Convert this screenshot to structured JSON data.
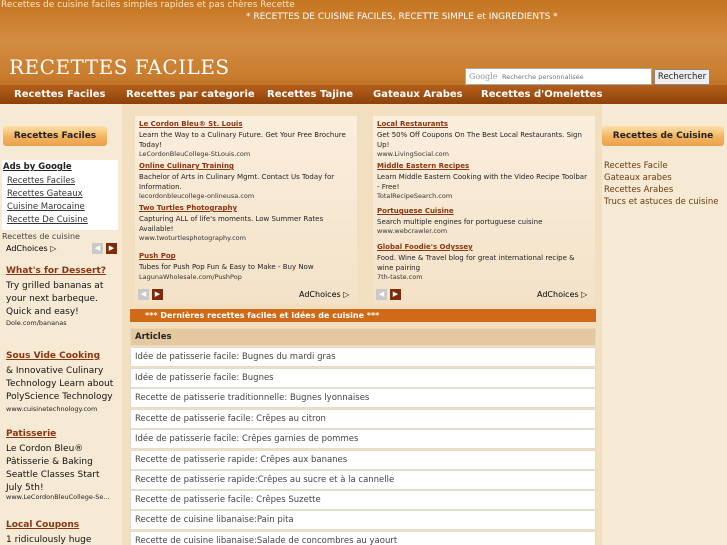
{
  "header": {
    "top_tagline": "Recettes de cuisine faciles simples rapides et pas chères Recette",
    "banner": "* RECETTES DE CUISINE FACILES, RECETTE SIMPLE et INGREDIENTS *",
    "site_title": "RECETTES FACILES",
    "google_mark": "Google",
    "search_placeholder": "Recherche personnalisée",
    "search_button": "Rechercher"
  },
  "nav": {
    "items": [
      "Recettes Faciles",
      "Recettes par categorie",
      "Recettes Tajine",
      "Gateaux Arabes",
      "Recettes d'Omelettes"
    ]
  },
  "left": {
    "header": "Recettes Faciles",
    "ads_by_google": "Ads by Google",
    "links": [
      "Recettes Faciles",
      "Recettes Gateaux",
      "Cuisine Marocaine",
      "Recette De Cuisine"
    ],
    "sub_label": "Recettes de cuisine",
    "adchoices": "AdChoices",
    "ads": [
      {
        "title": "What's for Dessert?",
        "body": "Try grilled bananas at your next barbeque. Quick and easy!",
        "url": "Dole.com/bananas"
      },
      {
        "title": "Sous Vide Cooking",
        "body": "& Innovative Culinary Technology Learn about PolyScience Technology",
        "url": "www.cuisinetechnology.com"
      },
      {
        "title": "Patisserie",
        "body": "Le Cordon Bleu® Pâtisserie & Baking Seattle Classes Start July 5th!",
        "url": "www.LeCordonBleuCollege-Se..."
      },
      {
        "title": "Local Coupons",
        "body": "1 ridiculously huge",
        "url": ""
      }
    ]
  },
  "center": {
    "adchoices": "AdChoices",
    "ad_panels": [
      {
        "ads": [
          {
            "title": "Le Cordon Bleu® St. Louis",
            "text": "Learn the Way to a Culinary Future. Get Your Free Brochure Today!",
            "url": "LeCordonBleuCollege-StLouis.com"
          },
          {
            "title": "Online Culinary Training",
            "text": "Bachelor of Arts in Culinary Mgmt. Contact Us Today for Information.",
            "url": "lecordonbleucollege-onlineusa.com"
          },
          {
            "title": "Two Turtles Photography",
            "text": "Capturing ALL of life's moments. Low Summer Rates Available!",
            "url": "www.twoturtlesphotography.com"
          },
          {
            "title": "Push Pop",
            "text": "Tubes for Push Pop Fun & Easy to Make - Buy Now",
            "url": "LagunaWholesale.com/PushPop"
          }
        ]
      },
      {
        "ads": [
          {
            "title": "Local Restaurants",
            "text": "Get 50% Off Coupons On The Best Local Restaurants. Sign Up!",
            "url": "www.LivingSocial.com"
          },
          {
            "title": "Middle Eastern Recipes",
            "text": "Learn Middle Eastern Cooking with the Video Recipe Toolbar - Free!",
            "url": "TotalRecipeSearch.com"
          },
          {
            "title": "Portuguese Cuisine",
            "text": "Search multiple engines for portuguese cuisine",
            "url": "www.webcrawler.com"
          },
          {
            "title": "Global Foodie's Odyssey",
            "text": "Food. Wine & Travel blog for great international recipe & wine pairing",
            "url": "7th-taste.com"
          }
        ]
      }
    ],
    "latest_bar": "*** Dernières recettes faciles et idées de cuisine ***",
    "articles_header": "Articles",
    "articles": [
      "Idée de patisserie facile: Bugnes du mardi gras",
      "Idée de patisserie facile: Bugnes",
      "Recette de patisserie traditionnelle: Bugnes lyonnaises",
      "Recette de patisserie facile: Crêpes au citron",
      "Idée de patisserie facile: Crêpes garnies de pommes",
      "Recette de patisserie rapide: Crêpes aux bananes",
      "Recette de patisserie rapide:Crêpes au sucre et à la cannelle",
      "Recette de patisserie facile: Crêpes Suzette",
      "Recette de cuisine libanaise:Pain pita",
      "Recette de cuisine libanaise:Salade de concombres au yaourt"
    ]
  },
  "right": {
    "header": "Recettes de Cuisine",
    "links": [
      "Recettes Facile",
      "Gateaux arabes",
      "Recettes Arabes",
      "Trucs et astuces de cuisine"
    ]
  },
  "colors": {
    "header_orange": "#c5741f",
    "nav_brown": "#8d4209",
    "latest_bar": "#cf6b18",
    "link_brown": "#8b3510"
  }
}
